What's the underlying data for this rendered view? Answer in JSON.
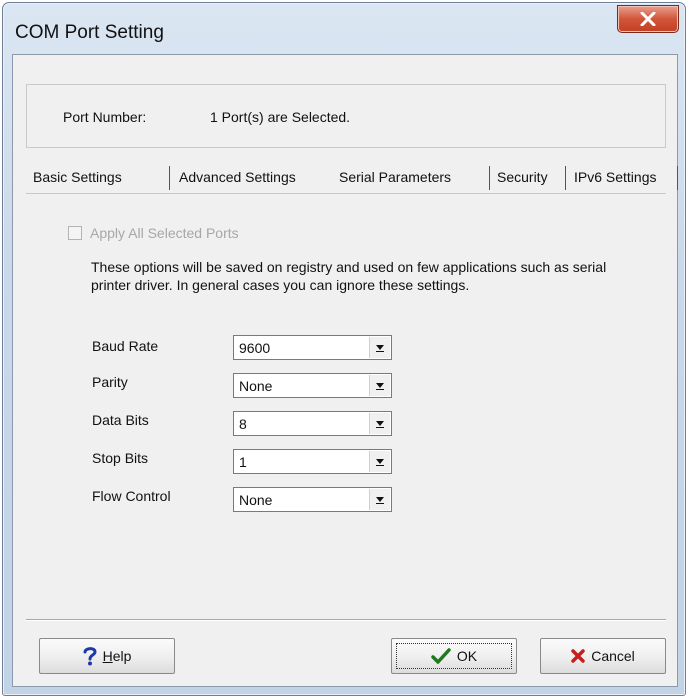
{
  "window": {
    "title": "COM Port Setting",
    "close_icon": "close-icon"
  },
  "port": {
    "label": "Port Number:",
    "value": "1 Port(s) are Selected."
  },
  "tabs": [
    {
      "label": "Basic Settings",
      "active": false
    },
    {
      "label": "Advanced Settings",
      "active": false
    },
    {
      "label": "Serial Parameters",
      "active": true
    },
    {
      "label": "Security",
      "active": false
    },
    {
      "label": "IPv6 Settings",
      "active": false
    }
  ],
  "serial": {
    "apply_all_label": "Apply All Selected Ports",
    "apply_all_checked": false,
    "apply_all_enabled": false,
    "note": "These options will be saved on registry and used on few applications such as serial printer driver. In general cases you can ignore these settings.",
    "fields": [
      {
        "label": "Baud Rate",
        "value": "9600"
      },
      {
        "label": "Parity",
        "value": "None"
      },
      {
        "label": "Data Bits",
        "value": "8"
      },
      {
        "label": "Stop Bits",
        "value": "1"
      },
      {
        "label": "Flow Control",
        "value": "None"
      }
    ]
  },
  "buttons": {
    "help": "Help",
    "ok": "OK",
    "cancel": "Cancel"
  },
  "colors": {
    "ok_check": "#1f7a1f",
    "cancel_x": "#c81e1e",
    "help_q": "#1b3aa8",
    "close_bg": "#c84a2f"
  }
}
